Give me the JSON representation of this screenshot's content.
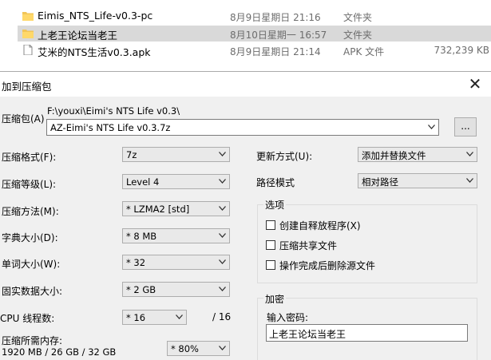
{
  "explorer": {
    "rows": [
      {
        "name": "Eimis_NTS_Life-v0.3-pc",
        "date": "8月9日星期日 21:16",
        "type": "文件夹",
        "size": ""
      },
      {
        "name": "上老王论坛当老王",
        "date": "8月10日星期一 16:57",
        "type": "文件夹",
        "size": ""
      },
      {
        "name": "艾米的NTS生活v0.3.apk",
        "date": "8月9日星期日 21:14",
        "type": "APK 文件",
        "size": "732,239 KB"
      }
    ]
  },
  "dialog": {
    "title": "加到压缩包",
    "close_glyph": "✕",
    "archive": {
      "label": "压缩包(A)",
      "path": "F:\\youxi\\Eimi's NTS Life v0.3\\",
      "value": "AZ-Eimi's NTS Life v0.3.7z",
      "browse_label": "..."
    },
    "left_options": [
      {
        "label": "压缩格式(F):",
        "value": "7z"
      },
      {
        "label": "压缩等级(L):",
        "value": "Level 4"
      },
      {
        "label": "压缩方法(M):",
        "value": "*  LZMA2 [std]"
      },
      {
        "label": "字典大小(D):",
        "value": "*  8 MB"
      },
      {
        "label": "单词大小(W):",
        "value": "*  32"
      },
      {
        "label": "固实数据大小:",
        "value": "*  2 GB"
      },
      {
        "label": "CPU 线程数:",
        "value": "*  16",
        "suffix": "/ 16"
      }
    ],
    "memory": {
      "label": "压缩所需内存:",
      "detail": "1920 MB / 26 GB / 32 GB",
      "value": "* 80%"
    },
    "update_mode": {
      "label": "更新方式(U):",
      "value": "添加并替换文件"
    },
    "path_mode": {
      "label": "路径模式",
      "value": "相对路径"
    },
    "options_group": {
      "title": "选项",
      "items": [
        {
          "label": "创建自释放程序(X)",
          "checked": false
        },
        {
          "label": "压缩共享文件",
          "checked": false
        },
        {
          "label": "操作完成后删除源文件",
          "checked": false
        }
      ]
    },
    "encryption": {
      "title": "加密",
      "password_label": "输入密码:",
      "password_value": "上老王论坛当老王"
    }
  }
}
